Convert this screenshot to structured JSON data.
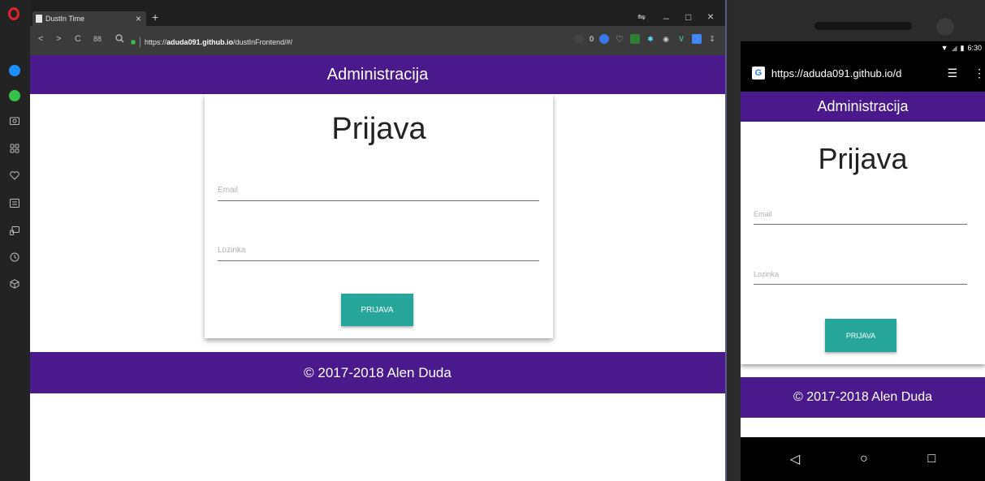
{
  "browser": {
    "tab_title": "DustIn Time",
    "tab_close": "×",
    "new_tab": "+",
    "url_prefix": "https://",
    "url_host": "aduda091.github.io",
    "url_path": "/dustInFrontend/#/",
    "badge_count": "0",
    "window_controls": {
      "menu": "⇋",
      "minimize": "_",
      "maximize": "□",
      "close": "×"
    },
    "nav": {
      "back": "<",
      "forward": ">",
      "reload": "C",
      "speed_dial": "88"
    }
  },
  "app": {
    "header_title": "Administracija",
    "login_title": "Prijava",
    "email_placeholder": "Email",
    "password_placeholder": "Lozinka",
    "login_button": "PRIJAVA",
    "footer_text": "© 2017-2018 Alen Duda"
  },
  "mobile": {
    "status_time": "6:30",
    "url": "https://aduda091.github.io/d",
    "header_title": "Administracija",
    "login_title": "Prijava",
    "email_placeholder": "Email",
    "password_placeholder": "Lozinka",
    "login_button": "PRIJAVA",
    "footer_text": "© 2017-2018 Alen Duda",
    "nav": {
      "back": "◁",
      "home": "○",
      "recents": "□"
    }
  },
  "colors": {
    "brand_purple": "#4a1a8c",
    "button_teal": "#26a69a"
  },
  "icons": [
    "opera-logo-icon",
    "messenger-icon",
    "whatsapp-icon",
    "camera-icon",
    "speed-dial-icon",
    "heart-icon",
    "news-icon",
    "flow-icon",
    "history-icon",
    "extensions-icon"
  ]
}
